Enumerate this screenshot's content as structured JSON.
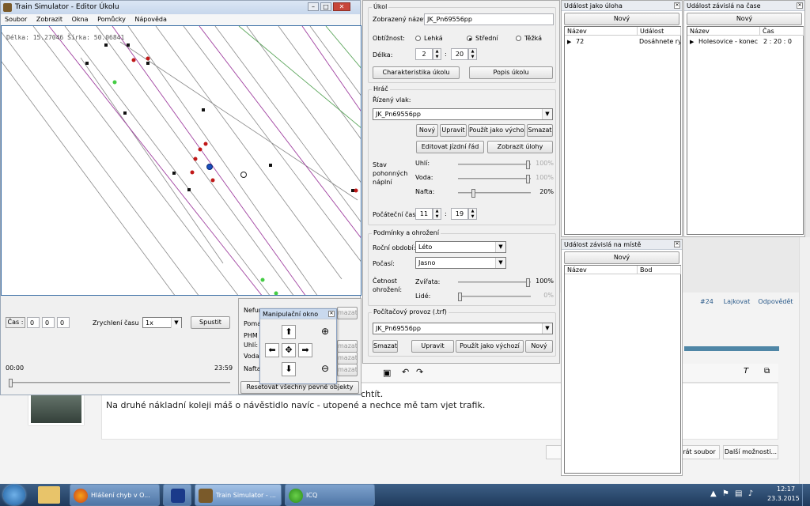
{
  "editor": {
    "title": "Train Simulator - Editor Úkolu",
    "menu": [
      "Soubor",
      "Zobrazit",
      "Okna",
      "Pomůcky",
      "Nápověda"
    ],
    "coords": "Délka: 15.27046 Šírka: 50.06841",
    "time_label": "Čas :",
    "time_h": "0",
    "time_m": "0",
    "time_s": "0",
    "accel_label": "Zrychlení času",
    "accel_value": "1x",
    "run_button": "Spustit",
    "timeline_start": "00:00",
    "timeline_end": "23:59",
    "behind_labels": [
      "Nefun",
      "Poma",
      "PHM",
      "Uhlí:",
      "Voda:",
      "Nafta"
    ],
    "behind_buttons": [
      "mazat",
      "mazat",
      "mazat",
      "mazat"
    ],
    "reset_button": "Resetovat všechny pevné objekty"
  },
  "manip": {
    "title": "Manipulační okno"
  },
  "ukol": {
    "group_title": "Úkol",
    "name_label": "Zobrazený název:",
    "name_value": "JK_Pn69556pp",
    "difficulty_label": "Obtížnost:",
    "difficulty_options": [
      "Lehká",
      "Střední",
      "Těžká"
    ],
    "length_label": "Délka:",
    "length_h": "2",
    "length_m": "20",
    "char_button": "Charakteristika úkolu",
    "desc_button": "Popis úkolu"
  },
  "hrac": {
    "group_title": "Hráč",
    "train_label": "Řízený vlak:",
    "train_value": "JK_Pn69556pp",
    "buttons_row1": [
      "Nový",
      "Upravit",
      "Použít jako výchozí",
      "Smazat"
    ],
    "timetable_button": "Editovat jízdní řád",
    "show_tasks_button": "Zobrazit úlohy",
    "fuel_label": "Stav pohonných náplní",
    "fuel": [
      {
        "name": "Uhlí:",
        "value": "100%",
        "pct": 100,
        "enabled": false
      },
      {
        "name": "Voda:",
        "value": "100%",
        "pct": 100,
        "enabled": false
      },
      {
        "name": "Nafta:",
        "value": "20%",
        "pct": 20,
        "enabled": true
      }
    ],
    "start_time_label": "Počáteční čas:",
    "start_h": "11",
    "start_m": "19"
  },
  "conditions": {
    "group_title": "Podmínky a ohrožení",
    "season_label": "Roční období:",
    "season_value": "Léto",
    "weather_label": "Počasí:",
    "weather_value": "Jasno",
    "threat_label": "Četnost ohrožení:",
    "animals_label": "Zvířata:",
    "animals_value": "100%",
    "animals_pct": 100,
    "people_label": "Lidé:",
    "people_value": "0%",
    "people_pct": 0
  },
  "traffic": {
    "group_title": "Počítačový provoz (.trf)",
    "value": "JK_Pn69556pp",
    "buttons": [
      "Smazat",
      "Upravit",
      "Použít jako výchozí",
      "Nový"
    ]
  },
  "event_task": {
    "title": "Událost jako úloha",
    "new_button": "Nový",
    "cols": [
      "Název",
      "Událost"
    ],
    "rows": [
      {
        "name": "72",
        "event": "Dosáhnete rychl"
      }
    ]
  },
  "event_time": {
    "title": "Událost závislá na čase",
    "new_button": "Nový",
    "cols": [
      "Název",
      "Čas"
    ],
    "rows": [
      {
        "name": "Holesovice - konec",
        "time": "2 : 20 : 0"
      }
    ]
  },
  "event_place": {
    "title": "Událost závislá na místě",
    "new_button": "Nový",
    "cols": [
      "Název",
      "Bod"
    ]
  },
  "browser": {
    "post_number": "#24",
    "like": "Lajkovat",
    "reply": "Odpovědět",
    "line1": "chtít.",
    "line2": "Na druhé nákladní koleji máš o návěstidlo navíc - utopené a nechce mě tam vjet trafik.",
    "attach_button": "rát soubor",
    "more_button": "Další možnosti..."
  },
  "taskbar": {
    "items": [
      "Hlášení chyb v O...",
      "",
      "Train Simulator - ...",
      "ICQ"
    ],
    "time": "12:17",
    "date": "23.3.2015"
  }
}
